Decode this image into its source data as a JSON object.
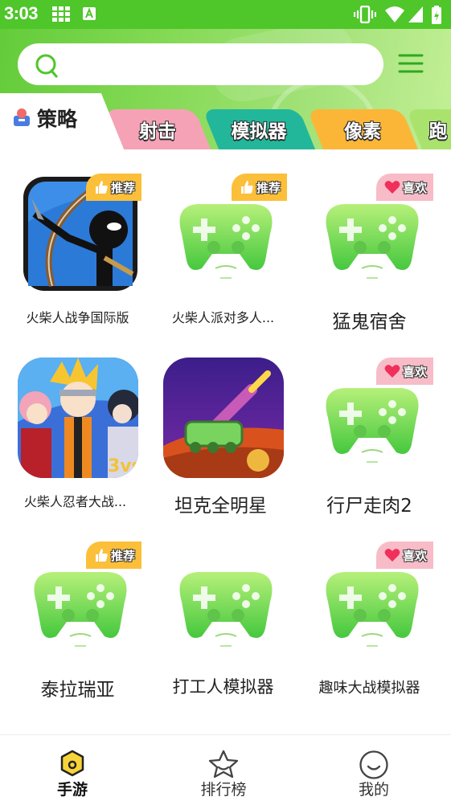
{
  "status_bar": {
    "time": "3:03"
  },
  "search": {
    "placeholder": ""
  },
  "tabs": {
    "active": "策略",
    "items": [
      "射击",
      "模拟器",
      "像素",
      "跑"
    ]
  },
  "badges": {
    "recommend": "推荐",
    "like": "喜欢"
  },
  "games": [
    {
      "name": "火柴人战争国际版",
      "badge": "推荐"
    },
    {
      "name": "火柴人派对多人...",
      "badge": "推荐"
    },
    {
      "name": "猛鬼宿舍",
      "badge": "喜欢"
    },
    {
      "name": "火柴人忍者大战...",
      "badge": ""
    },
    {
      "name": "坦克全明星",
      "badge": ""
    },
    {
      "name": "行尸走肉2",
      "badge": "喜欢"
    },
    {
      "name": "泰拉瑞亚",
      "badge": "推荐"
    },
    {
      "name": "打工人模拟器",
      "badge": ""
    },
    {
      "name": "趣味大战模拟器",
      "badge": "喜欢"
    }
  ],
  "bottom_nav": [
    {
      "label": "手游",
      "icon": "home-hexagon-icon",
      "active": true
    },
    {
      "label": "排行榜",
      "icon": "star-icon",
      "active": false
    },
    {
      "label": "我的",
      "icon": "smile-face-icon",
      "active": false
    }
  ],
  "colors": {
    "brand_green": "#4fc62a",
    "tab_pink": "#f6a2b6",
    "tab_teal": "#22b79a",
    "tab_orange": "#fbb638",
    "badge_recommend": "#fcbf3a",
    "badge_like": "#f7bcc7"
  }
}
